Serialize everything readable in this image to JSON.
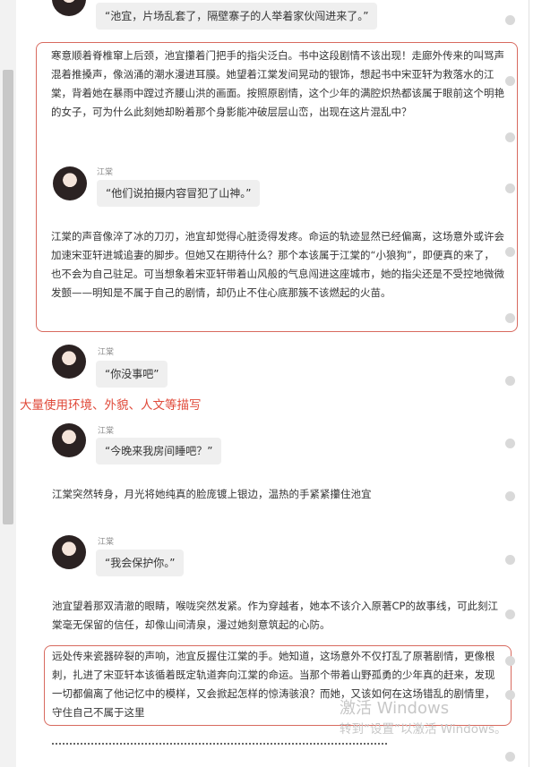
{
  "top_bubble": {
    "text": "“池宜，片场乱套了，隔壁寨子的人举着家伙闯进来了。”"
  },
  "box1": {
    "para1": "寒意顺着脊椎窜上后颈，池宜攥着门把手的指尖泛白。书中这段剧情不该出现！走廊外传来的叫骂声混着推搡声，像汹涌的潮水漫进耳膜。她望着江棠发间晃动的银饰，想起书中宋亚轩为救落水的江棠，背着她在暴雨中蹚过齐腰山洪的画面。按照原剧情，这个少年的满腔炽热都该属于眼前这个明艳的女子，可为什么此刻她却盼着那个身影能冲破层层山峦，出现在这片混乱中？",
    "speaker": "江棠",
    "bubble": "“他们说拍摄内容冒犯了山神。”",
    "para2": "江棠的声音像淬了冰的刀刃，池宜却觉得心脏烫得发疼。命运的轨迹显然已经偏离，这场意外或许会加速宋亚轩进城追妻的脚步。但她又在期待什么？那个本该属于江棠的“小狼狗”，即便真的来了，也不会为自己驻足。可当想象着宋亚轩带着山风般的气息闯进这座城市，她的指尖还是不受控地微微发颤——明知是不属于自己的剧情，却仍止不住心底那簇不该燃起的火苗。"
  },
  "chat1": {
    "speaker": "江棠",
    "bubble": "“你没事吧”"
  },
  "annotation": "大量使用环境、外貌、人文等描写",
  "chat2": {
    "speaker": "江棠",
    "bubble": "“今晚来我房间睡吧？”"
  },
  "para3": "江棠突然转身，月光将她纯真的脸庞镀上银边，温热的手紧紧攥住池宜",
  "chat3": {
    "speaker": "江棠",
    "bubble": "“我会保护你。”"
  },
  "para4": "池宜望着那双清澈的眼睛，喉咙突然发紧。作为穿越者，她本不该介入原著CP的故事线，可此刻江棠毫无保留的信任，却像山间清泉，漫过她刻意筑起的心防。",
  "box2": {
    "para": "远处传来瓷器碎裂的声响，池宜反握住江棠的手。她知道，这场意外不仅打乱了原著剧情，更像根刺，扎进了宋亚轩本该循着既定轨道奔向江棠的命运。当那个带着山野孤勇的少年真的赶来，发现一切都偏离了他记忆中的模样，又会掀起怎样的惊涛骇浪？而她，又该如何在这场错乱的剧情里，守住自己不属于这里"
  },
  "watermark": {
    "line1": "激活 Windows",
    "line2": "转到“设置”以激活 Windows。"
  }
}
